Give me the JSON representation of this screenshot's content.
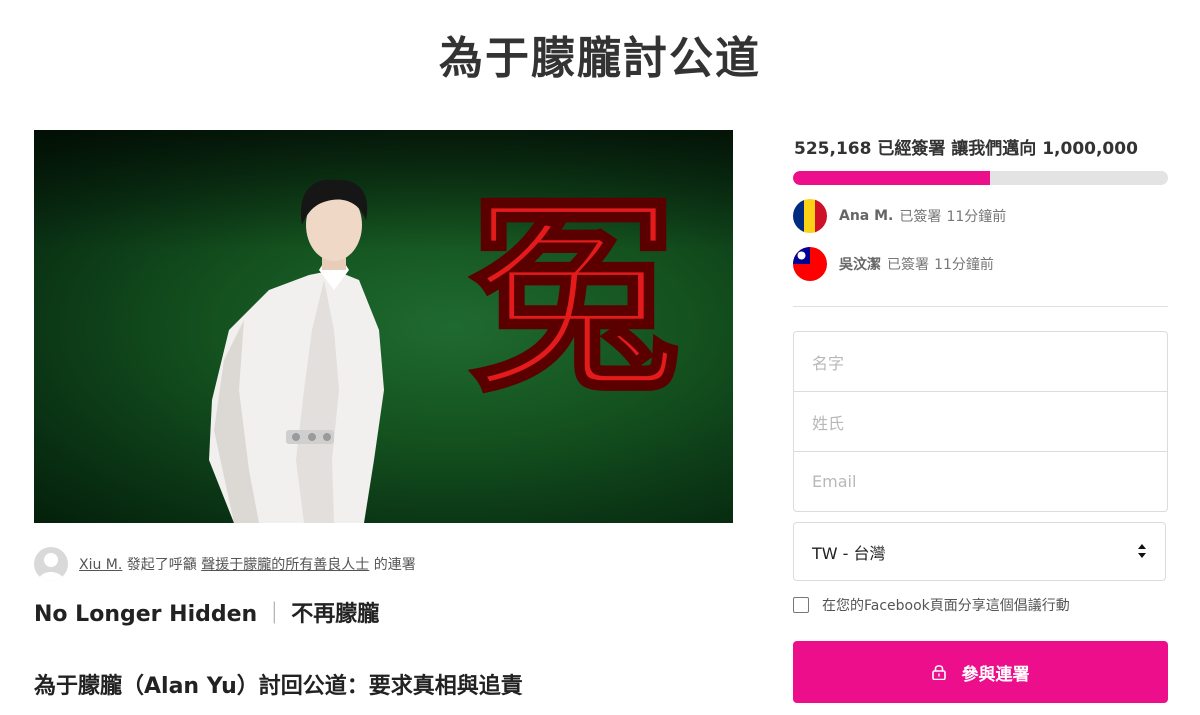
{
  "page": {
    "title": "為于朦朧討公道"
  },
  "hero": {
    "calligraphy": "冤"
  },
  "starter": {
    "name": "Xiu M.",
    "action": "發起了呼籲",
    "target": "聲援于朦朧的所有善良人士",
    "suffix": "的連署"
  },
  "petition": {
    "subheading_en": "No Longer Hidden",
    "subheading_zh": "不再朦朧",
    "headline": "為于朦朧（Alan Yu）討回公道：要求真相與追責"
  },
  "progress": {
    "signed_count": "525,168",
    "signed_label": "已經簽署 讓我們邁向",
    "goal": "1,000,000",
    "fraction": 0.525,
    "fill_color": "#ec0e8b"
  },
  "recent_signers": [
    {
      "name": "Ana M.",
      "status": "已簽署",
      "time": "11分鐘前",
      "flag": "romania-flag-icon"
    },
    {
      "name": "吳汶潔",
      "status": "已簽署",
      "time": "11分鐘前",
      "flag": "taiwan-flag-icon"
    }
  ],
  "form": {
    "first_name_placeholder": "名字",
    "last_name_placeholder": "姓氏",
    "email_placeholder": "Email",
    "country_value": "TW - 台灣",
    "facebook_share_label": "在您的Facebook頁面分享這個倡議行動",
    "sign_button_label": "參與連署",
    "button_color": "#ec0e8b"
  }
}
